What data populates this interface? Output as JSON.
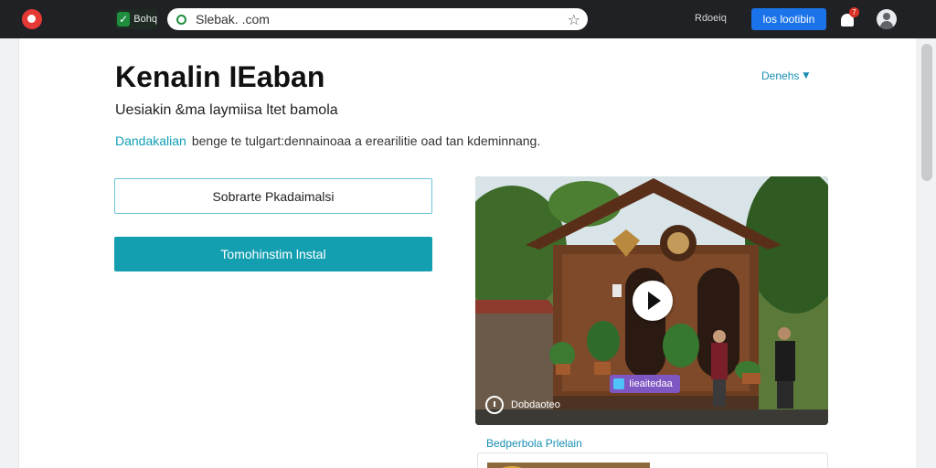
{
  "browser": {
    "extension_label": "Bohq",
    "url": "Slebak. .com",
    "account_text": "Rdoeiq",
    "cta_label": "los lootibin",
    "notification_count": "7"
  },
  "page": {
    "title": "Kenalin IEaban",
    "language_select": "Denehs",
    "subtitle": "Uesiakin &ma laymiisa ltet bamola",
    "description_link": "Dandakalian",
    "description_text": "benge te tulgart:dennainoaa a erearilitie oad tan kdeminnang.",
    "secondary_button": "Sobrarte Pkadaimalsi",
    "primary_button": "Tomohinstim lnstal"
  },
  "video": {
    "tag_label": "Iieaitedaa",
    "caption": "Dobdaoteo"
  },
  "related": {
    "section_label": "Bedperbola Prlelain"
  },
  "colors": {
    "topbar": "#202124",
    "accent_teal": "#149fb1",
    "cta_blue": "#1a73e8",
    "link": "#1a8fb3"
  },
  "icons": {
    "app_logo": "app-logo-icon",
    "extension": "check-icon",
    "lock": "lock-icon",
    "bookmark": "star-icon",
    "notification": "bell-icon",
    "avatar": "user-icon",
    "play": "play-icon",
    "caption": "info-icon"
  }
}
